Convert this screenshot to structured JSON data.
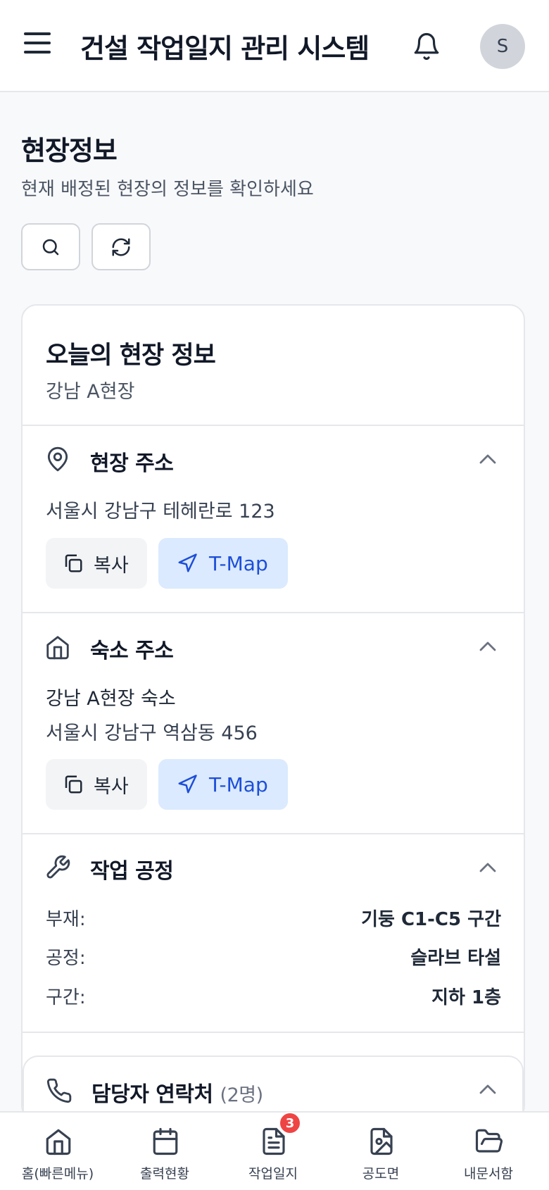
{
  "header": {
    "title": "건설 작업일지 관리 시스템",
    "avatar_initial": "S"
  },
  "page": {
    "title": "현장정보",
    "subtitle": "현재 배정된 현장의 정보를 확인하세요"
  },
  "card": {
    "title": "오늘의 현장 정보",
    "site_name": "강남 A현장",
    "site_address": {
      "title": "현장 주소",
      "address": "서울시 강남구 테헤란로 123",
      "copy_label": "복사",
      "tmap_label": "T-Map"
    },
    "lodging_address": {
      "title": "숙소 주소",
      "name": "강남 A현장 숙소",
      "address": "서울시 강남구 역삼동 456",
      "copy_label": "복사",
      "tmap_label": "T-Map"
    },
    "work_process": {
      "title": "작업 공정",
      "rows": [
        {
          "label": "부재:",
          "value": "기둥 C1-C5 구간"
        },
        {
          "label": "공정:",
          "value": "슬라브 타설"
        },
        {
          "label": "구간:",
          "value": "지하 1층"
        }
      ]
    },
    "contacts": {
      "title": "담당자 연락처",
      "count": "(2명)"
    }
  },
  "bottom_nav": {
    "items": [
      {
        "label": "홈(빠른메뉴)",
        "icon": "home-icon"
      },
      {
        "label": "출력현황",
        "icon": "calendar-icon"
      },
      {
        "label": "작업일지",
        "icon": "document-icon"
      },
      {
        "label": "공도면",
        "icon": "drawing-file-icon"
      },
      {
        "label": "내문서함",
        "icon": "folder-open-icon"
      }
    ],
    "badge": "3"
  },
  "colors": {
    "accent": "#1d4ed8",
    "accent_bg": "#dbeafe",
    "badge": "#ef4444"
  }
}
